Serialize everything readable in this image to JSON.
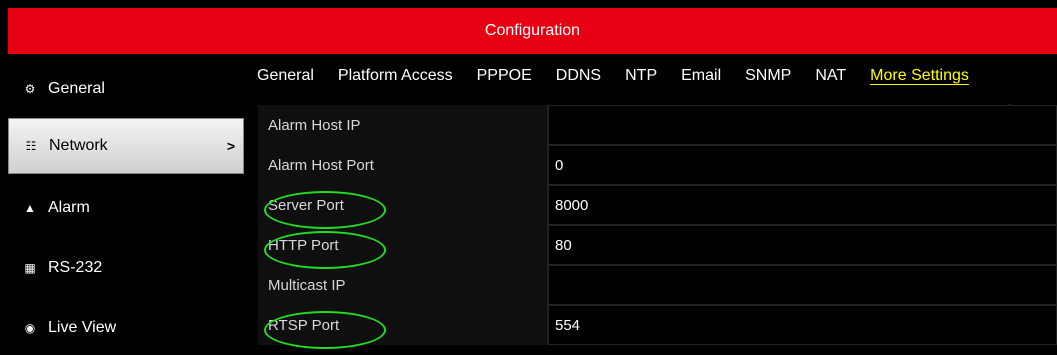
{
  "window": {
    "title": "Configuration"
  },
  "sidebar": {
    "items": [
      {
        "label": "General",
        "icon": "gear-icon",
        "active": false
      },
      {
        "label": "Network",
        "icon": "network-icon",
        "active": true
      },
      {
        "label": "Alarm",
        "icon": "alarm-icon",
        "active": false
      },
      {
        "label": "RS-232",
        "icon": "serial-port-icon",
        "active": false
      },
      {
        "label": "Live View",
        "icon": "eye-icon",
        "active": false
      }
    ],
    "active_chevron": ">"
  },
  "tabs": [
    {
      "label": "General",
      "active": false
    },
    {
      "label": "Platform Access",
      "active": false
    },
    {
      "label": "PPPOE",
      "active": false
    },
    {
      "label": "DDNS",
      "active": false
    },
    {
      "label": "NTP",
      "active": false
    },
    {
      "label": "Email",
      "active": false
    },
    {
      "label": "SNMP",
      "active": false
    },
    {
      "label": "NAT",
      "active": false
    },
    {
      "label": "More Settings",
      "active": true
    }
  ],
  "settings": {
    "rows": [
      {
        "label": "Alarm Host IP",
        "value": "",
        "highlighted": false
      },
      {
        "label": "Alarm Host Port",
        "value": "0",
        "highlighted": false
      },
      {
        "label": "Server Port",
        "value": "8000",
        "highlighted": true
      },
      {
        "label": "HTTP Port",
        "value": "80",
        "highlighted": true
      },
      {
        "label": "Multicast IP",
        "value": "",
        "highlighted": false
      },
      {
        "label": "RTSP Port",
        "value": "554",
        "highlighted": true
      }
    ]
  },
  "colors": {
    "title_bar": "#e60012",
    "active_tab": "#ffff00",
    "highlight_circle": "#22dd22"
  }
}
